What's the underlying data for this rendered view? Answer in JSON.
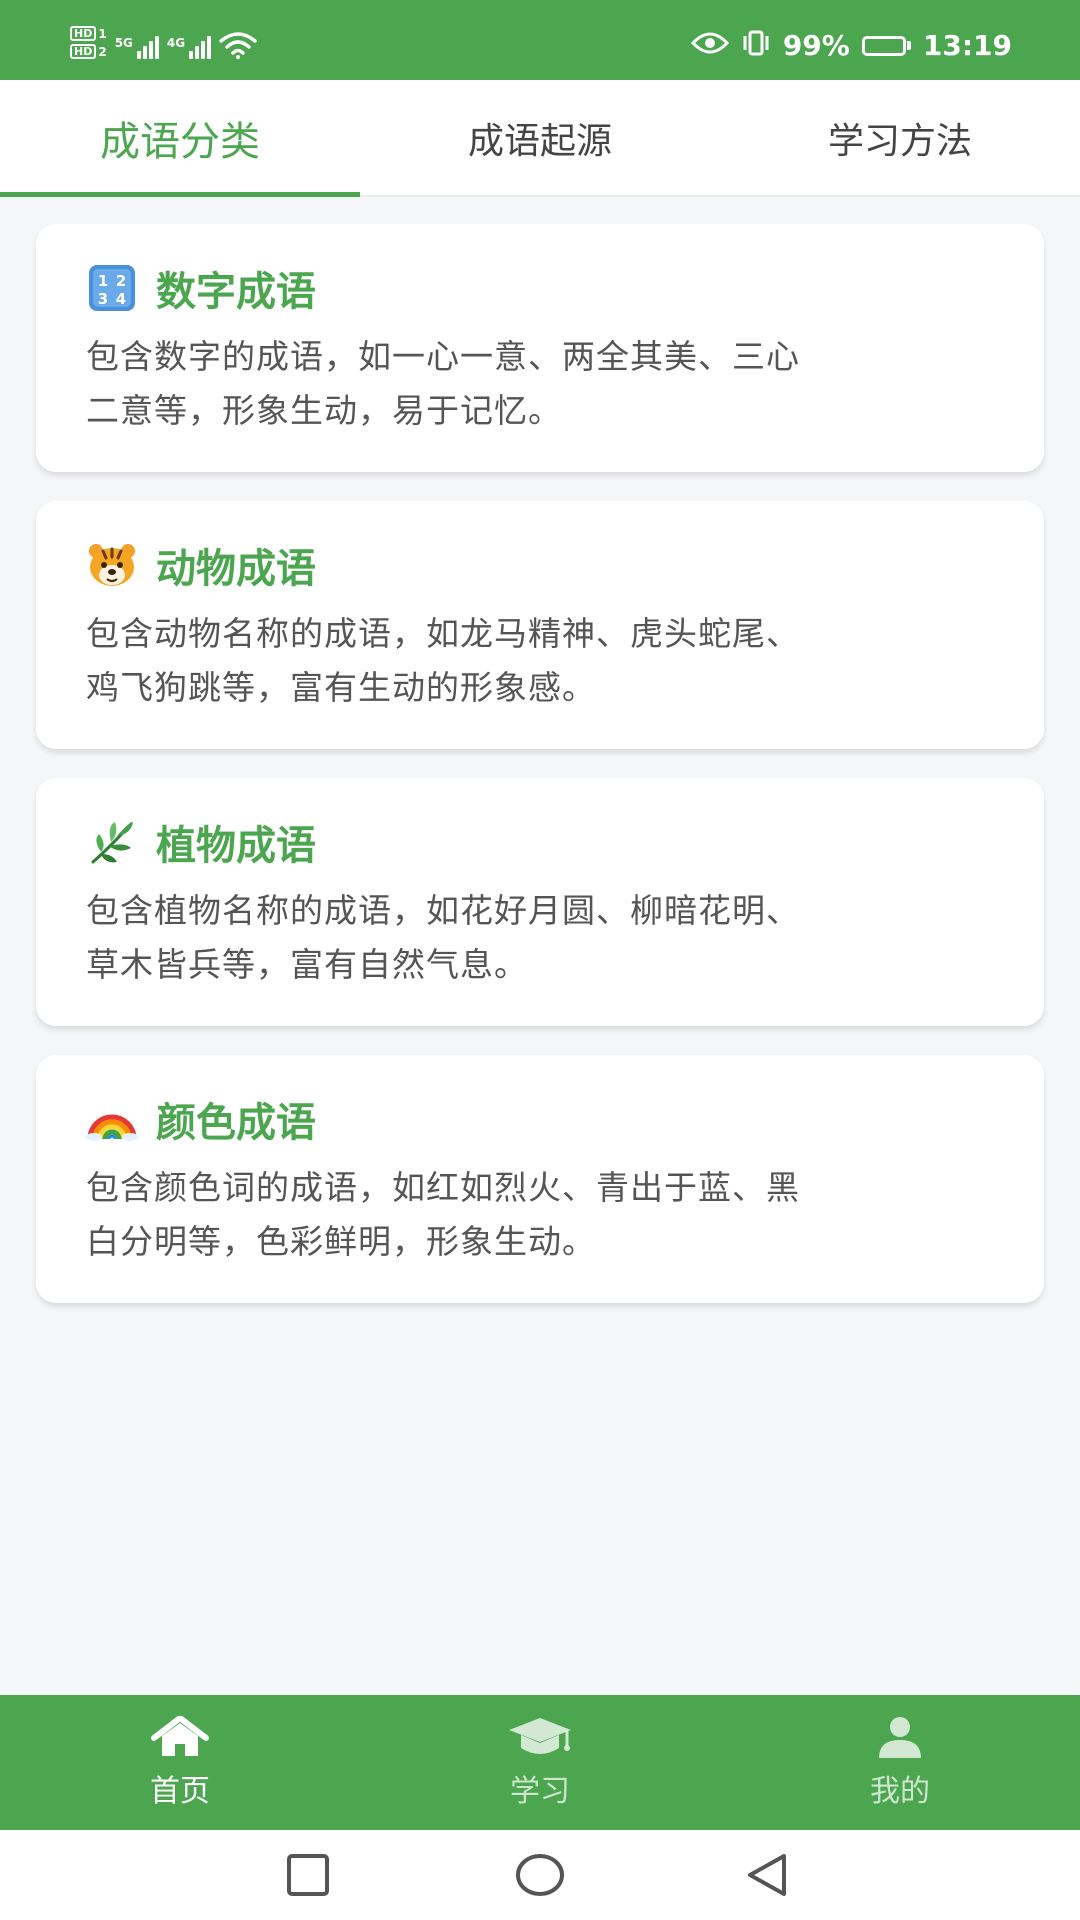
{
  "status_bar": {
    "sim1": "HD",
    "sim1_index": "1",
    "sim2": "HD",
    "sim2_index": "2",
    "net1": "5G",
    "net2": "4G",
    "battery_pct_text": "99%",
    "battery_level": 0.99,
    "time": "13:19"
  },
  "tabs": [
    {
      "label": "成语分类",
      "active": true
    },
    {
      "label": "成语起源",
      "active": false
    },
    {
      "label": "学习方法",
      "active": false
    }
  ],
  "cards": [
    {
      "icon": "numbers-keycap-icon",
      "title": "数字成语",
      "desc_line1": "包含数字的成语，如一心一意、两全其美、三心",
      "desc_line2": "二意等，形象生动，易于记忆。"
    },
    {
      "icon": "tiger-face-icon",
      "title": "动物成语",
      "desc_line1": "包含动物名称的成语，如龙马精神、虎头蛇尾、",
      "desc_line2": "鸡飞狗跳等，富有生动的形象感。"
    },
    {
      "icon": "herb-leaf-icon",
      "title": "植物成语",
      "desc_line1": "包含植物名称的成语，如花好月圆、柳暗花明、",
      "desc_line2": "草木皆兵等，富有自然气息。"
    },
    {
      "icon": "rainbow-icon",
      "title": "颜色成语",
      "desc_line1": "包含颜色词的成语，如红如烈火、青出于蓝、黑",
      "desc_line2": "白分明等，色彩鲜明，形象生动。"
    }
  ],
  "bottom_nav": [
    {
      "label": "首页",
      "icon": "home-icon",
      "active": true
    },
    {
      "label": "学习",
      "icon": "graduation-cap-icon",
      "active": false
    },
    {
      "label": "我的",
      "icon": "user-icon",
      "active": false
    }
  ],
  "colors": {
    "primary": "#4ca54f",
    "background": "#f5f6f8",
    "card": "#ffffff",
    "text": "#555555"
  }
}
